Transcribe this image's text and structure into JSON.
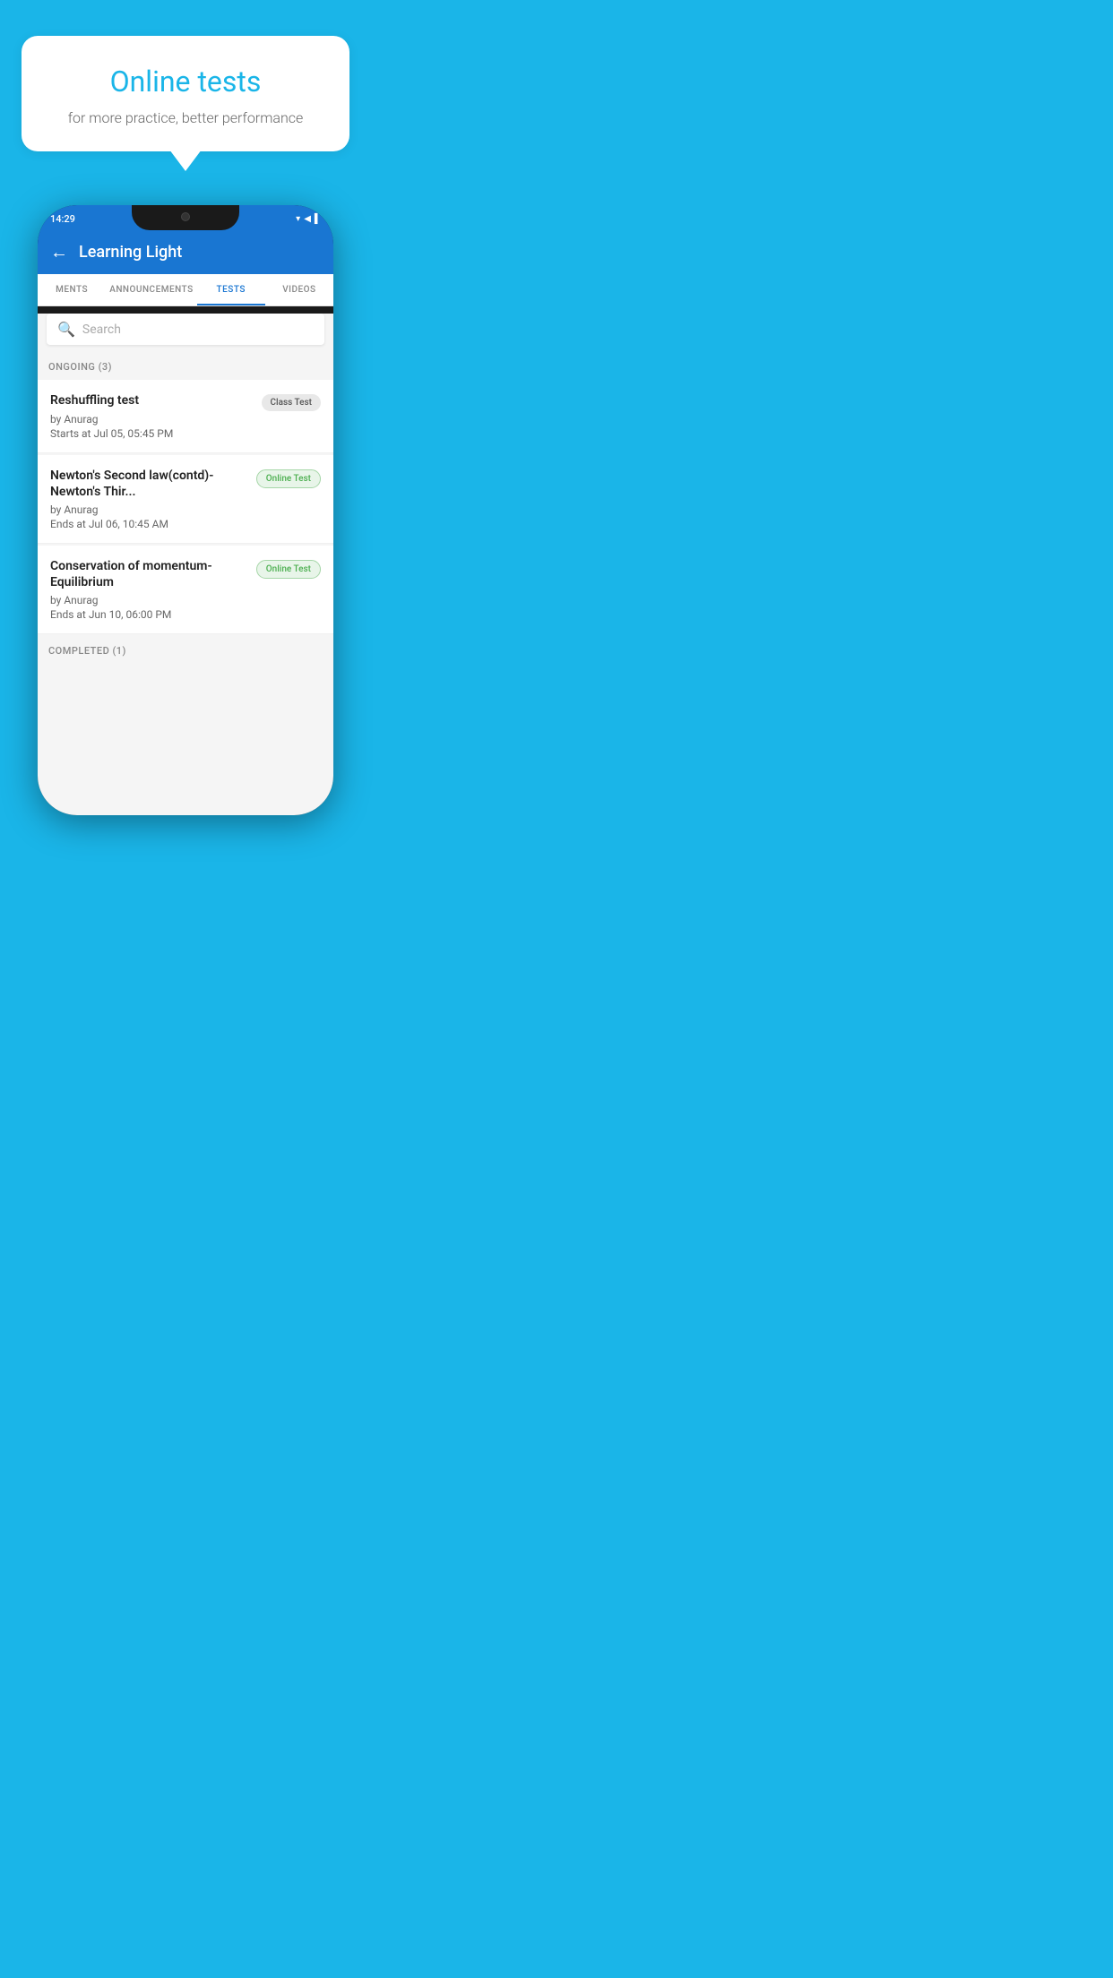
{
  "background": {
    "color": "#1ab5e8"
  },
  "bubble": {
    "title": "Online tests",
    "subtitle": "for more practice, better performance"
  },
  "phone": {
    "statusBar": {
      "time": "14:29",
      "icons": "▾◀▌"
    },
    "appBar": {
      "title": "Learning Light",
      "backLabel": "←"
    },
    "tabs": [
      {
        "label": "MENTS",
        "active": false
      },
      {
        "label": "ANNOUNCEMENTS",
        "active": false
      },
      {
        "label": "TESTS",
        "active": true
      },
      {
        "label": "VIDEOS",
        "active": false
      }
    ],
    "search": {
      "placeholder": "Search"
    },
    "ongoingSection": {
      "label": "ONGOING (3)"
    },
    "tests": [
      {
        "title": "Reshuffling test",
        "author": "by Anurag",
        "date": "Starts at  Jul 05, 05:45 PM",
        "badge": "Class Test",
        "badgeType": "class"
      },
      {
        "title": "Newton's Second law(contd)-Newton's Thir...",
        "author": "by Anurag",
        "date": "Ends at  Jul 06, 10:45 AM",
        "badge": "Online Test",
        "badgeType": "online"
      },
      {
        "title": "Conservation of momentum-Equilibrium",
        "author": "by Anurag",
        "date": "Ends at  Jun 10, 06:00 PM",
        "badge": "Online Test",
        "badgeType": "online"
      }
    ],
    "completedSection": {
      "label": "COMPLETED (1)"
    }
  }
}
